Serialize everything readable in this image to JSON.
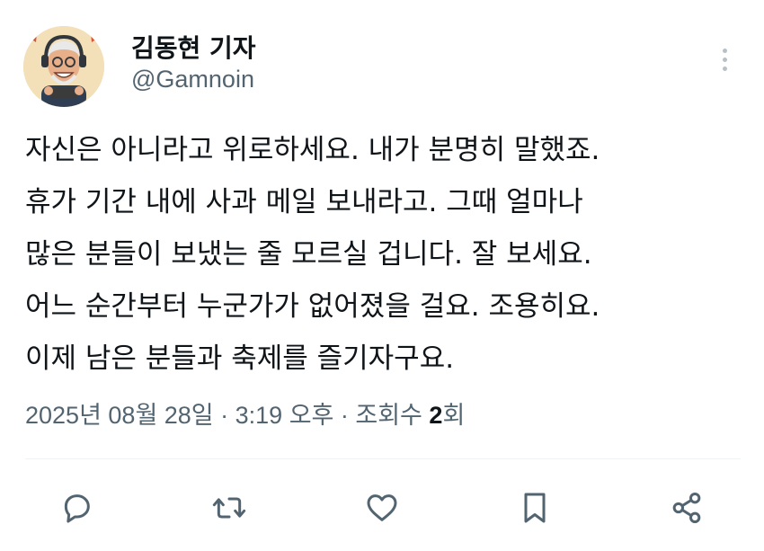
{
  "author": {
    "name": "김동현 기자",
    "handle": "@Gamnoin"
  },
  "tweet": {
    "lines": [
      "자신은 아니라고 위로하세요. 내가 분명히 말했죠.",
      "휴가 기간 내에 사과 메일 보내라고. 그때 얼마나",
      "많은 분들이 보냈는 줄 모르실 겁니다. 잘 보세요.",
      "어느 순간부터 누군가가 없어졌을 걸요. 조용히요.",
      "이제 남은 분들과 축제를 즐기자구요."
    ]
  },
  "meta": {
    "timestamp": "2025년 08월 28일 · 3:19 오후 · 조회수 ",
    "views_count": "2",
    "views_suffix": "회"
  },
  "colors": {
    "text": "#0f1419",
    "secondary": "#536471",
    "divider": "#eff3f4"
  },
  "icons": [
    "more-icon",
    "reply-icon",
    "retweet-icon",
    "like-icon",
    "bookmark-icon",
    "share-icon"
  ]
}
